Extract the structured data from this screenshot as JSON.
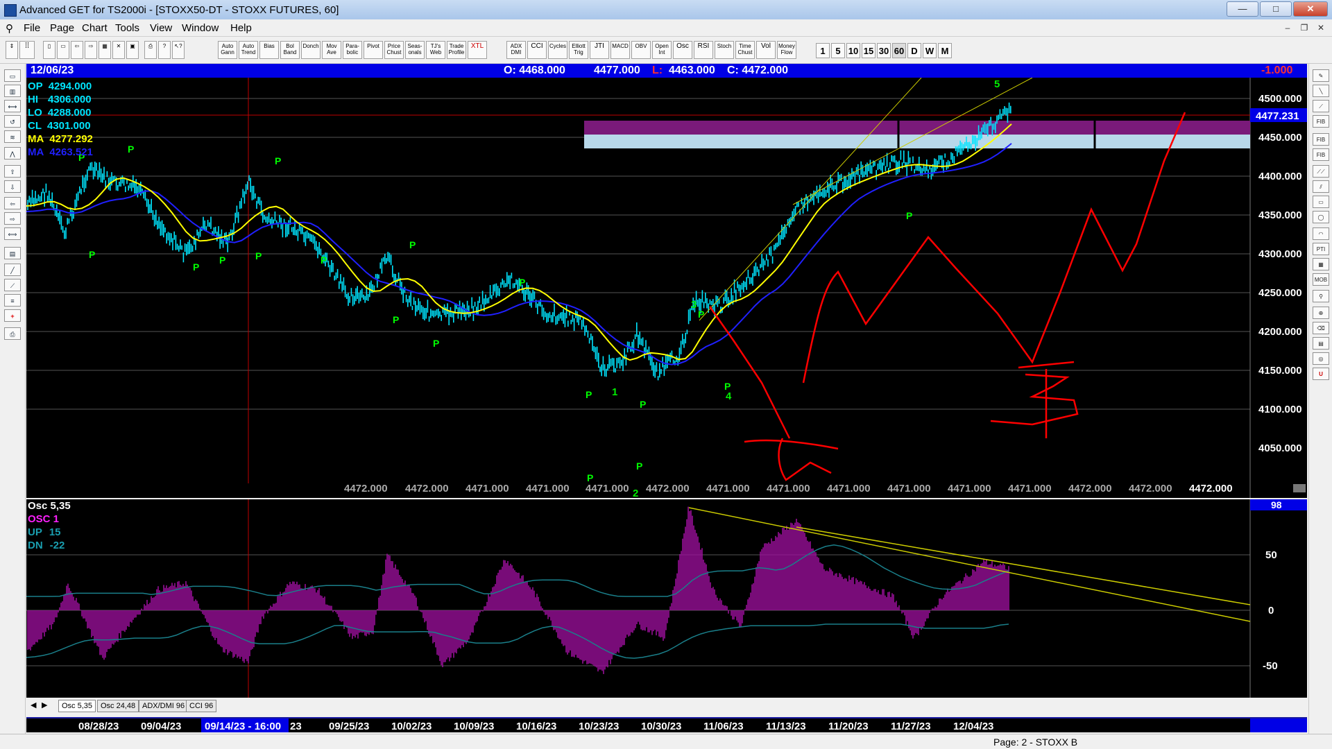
{
  "window": {
    "title": "Advanced GET for TS2000i - [STOXX50-DT - STOXX FUTURES, 60]",
    "min": "—",
    "max": "□",
    "close": "✕"
  },
  "menu": [
    "File",
    "Page",
    "Chart",
    "Tools",
    "View",
    "Window",
    "Help"
  ],
  "toolbar": {
    "buttons": [
      "Auto Gann",
      "Auto Trend",
      "Bias",
      "Bol Band",
      "Donch",
      "Mov Ave",
      "Para- bolic",
      "Pivot",
      "Price Chust",
      "Seas- onals",
      "TJ's Web",
      "Trade Profile",
      "XTL",
      "ADX DMI",
      "CCI",
      "Cycles",
      "Elliott Trig",
      "JTI",
      "MACD",
      "OBV",
      "Open Int",
      "Osc",
      "RSI",
      "Stoch",
      "Time Chust",
      "Vol",
      "Money Flow"
    ],
    "timeframes": [
      "1",
      "5",
      "10",
      "15",
      "30",
      "60",
      "D",
      "W",
      "M"
    ]
  },
  "info": {
    "date": "12/06/23",
    "open": "O: 4468.000",
    "high": "4477.000",
    "low_label": "L:",
    "low": "4463.000",
    "close": "C: 4472.000",
    "change": "-1.000"
  },
  "legend": [
    {
      "label": "OP",
      "value": "4294.000",
      "color": "#00e5ff"
    },
    {
      "label": "HI",
      "value": "4306.000",
      "color": "#00e5ff"
    },
    {
      "label": "LO",
      "value": "4288.000",
      "color": "#00e5ff"
    },
    {
      "label": "CL",
      "value": "4301.000",
      "color": "#00e5ff"
    },
    {
      "label": "MA",
      "value": "4277.292",
      "color": "#ffff00"
    },
    {
      "label": "MA",
      "value": "4263.521",
      "color": "#2020ff"
    }
  ],
  "price_axis": [
    "4500.000",
    "4450.000",
    "4400.000",
    "4350.000",
    "4300.000",
    "4250.000",
    "4200.000",
    "4150.000",
    "4100.000",
    "4050.000"
  ],
  "current_price": "4477.231",
  "bottom_values": [
    "4472.000",
    "4472.000",
    "4471.000",
    "4471.000",
    "4471.000",
    "4472.000",
    "4471.000",
    "4471.000",
    "4471.000",
    "4471.000",
    "4471.000",
    "4471.000",
    "4472.000",
    "4472.000"
  ],
  "last_value": "4472.000",
  "wave_labels": [
    "5",
    "3",
    "4",
    "1",
    "2"
  ],
  "pivot_label": "P",
  "osc": {
    "title": "Osc 5,35",
    "osc_label": "OSC 1",
    "up_label": "UP",
    "up": "15",
    "dn_label": "DN",
    "dn": "-22",
    "axis": [
      "50",
      "0",
      "-50"
    ],
    "top_value": "98"
  },
  "tabs": [
    "Osc 5,35",
    "Osc 24,48",
    "ADX/DMI 96",
    "CCI 96"
  ],
  "dates": [
    "08/28/23",
    "09/04/23",
    "09/14/23 - 16:00",
    "23",
    "09/25/23",
    "10/02/23",
    "10/09/23",
    "10/16/23",
    "10/23/23",
    "10/30/23",
    "11/06/23",
    "11/13/23",
    "11/20/23",
    "11/27/23",
    "12/04/23"
  ],
  "status": "Page: 2 - STOXX B",
  "colors": {
    "bull": "#00e5ff",
    "ma_fast": "#ffff00",
    "ma_slow": "#2020ff",
    "zone": "#7a1a7a",
    "zone_light": "#b8d8ea",
    "annotation": "#ff0000",
    "osc": "#a010a0",
    "pivot": "#00ff00"
  }
}
